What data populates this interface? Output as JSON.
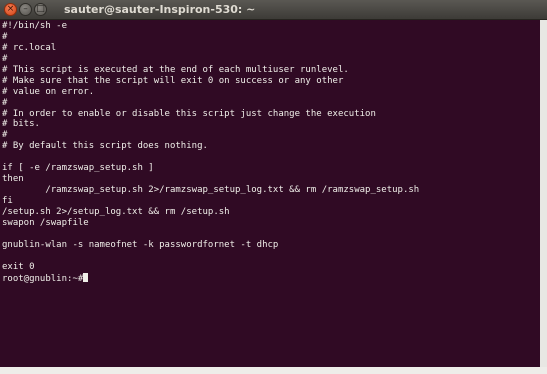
{
  "window": {
    "title": "sauter@sauter-Inspiron-530: ~",
    "controls": {
      "close_glyph": "×",
      "minimize_glyph": "–",
      "maximize_glyph": "□"
    }
  },
  "terminal": {
    "background": "#300a24",
    "foreground": "#f0efe9",
    "lines": [
      "#!/bin/sh -e",
      "#",
      "# rc.local",
      "#",
      "# This script is executed at the end of each multiuser runlevel.",
      "# Make sure that the script will exit 0 on success or any other",
      "# value on error.",
      "#",
      "# In order to enable or disable this script just change the execution",
      "# bits.",
      "#",
      "# By default this script does nothing.",
      "",
      "if [ -e /ramzswap_setup.sh ]",
      "then",
      "        /ramzswap_setup.sh 2>/ramzswap_setup_log.txt && rm /ramzswap_setup.sh",
      "fi",
      "/setup.sh 2>/setup_log.txt && rm /setup.sh",
      "swapon /swapfile",
      "",
      "gnublin-wlan -s nameofnet -k passwordfornet -t dhcp",
      "",
      "exit 0",
      "root@gnublin:~#"
    ]
  }
}
